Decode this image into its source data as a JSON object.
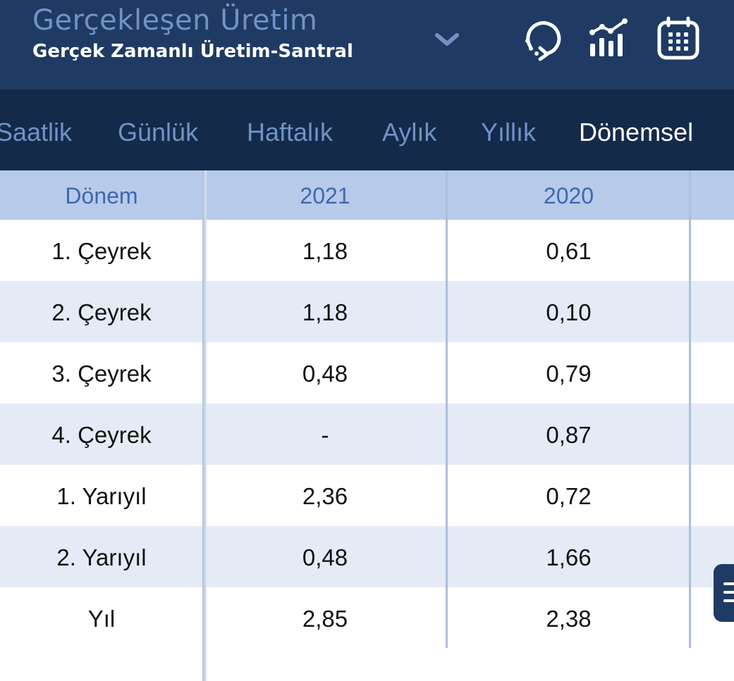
{
  "header": {
    "title": "Gerçekleşen Üretim",
    "subtitle": "Gerçek Zamanlı Üretim-Santral",
    "icons": [
      "chevron-down-icon",
      "refresh-icon",
      "statistics-icon",
      "calendar-icon"
    ]
  },
  "tabs": [
    {
      "label": "Saatlik",
      "active": false
    },
    {
      "label": "Günlük",
      "active": false
    },
    {
      "label": "Haftalık",
      "active": false
    },
    {
      "label": "Aylık",
      "active": false
    },
    {
      "label": "Yıllık",
      "active": false
    },
    {
      "label": "Dönemsel",
      "active": true
    }
  ],
  "table": {
    "headers": [
      "Dönem",
      "2021",
      "2020"
    ],
    "rows": [
      [
        "1. Çeyrek",
        "1,18",
        "0,61"
      ],
      [
        "2. Çeyrek",
        "1,18",
        "0,10"
      ],
      [
        "3. Çeyrek",
        "0,48",
        "0,79"
      ],
      [
        "4. Çeyrek",
        "-",
        "0,87"
      ],
      [
        "1. Yarıyıl",
        "2,36",
        "0,72"
      ],
      [
        "2. Yarıyıl",
        "0,48",
        "1,66"
      ],
      [
        "Yıl",
        "2,85",
        "2,38"
      ]
    ]
  },
  "side_button": {
    "icon": "menu-icon"
  },
  "colors": {
    "header_bg": "#1f3b64",
    "tabs_bg": "#142a4a",
    "accent": "#6f93c6",
    "table_header_bg": "#b7cae9",
    "row_alt_bg": "#e4ebf6"
  }
}
